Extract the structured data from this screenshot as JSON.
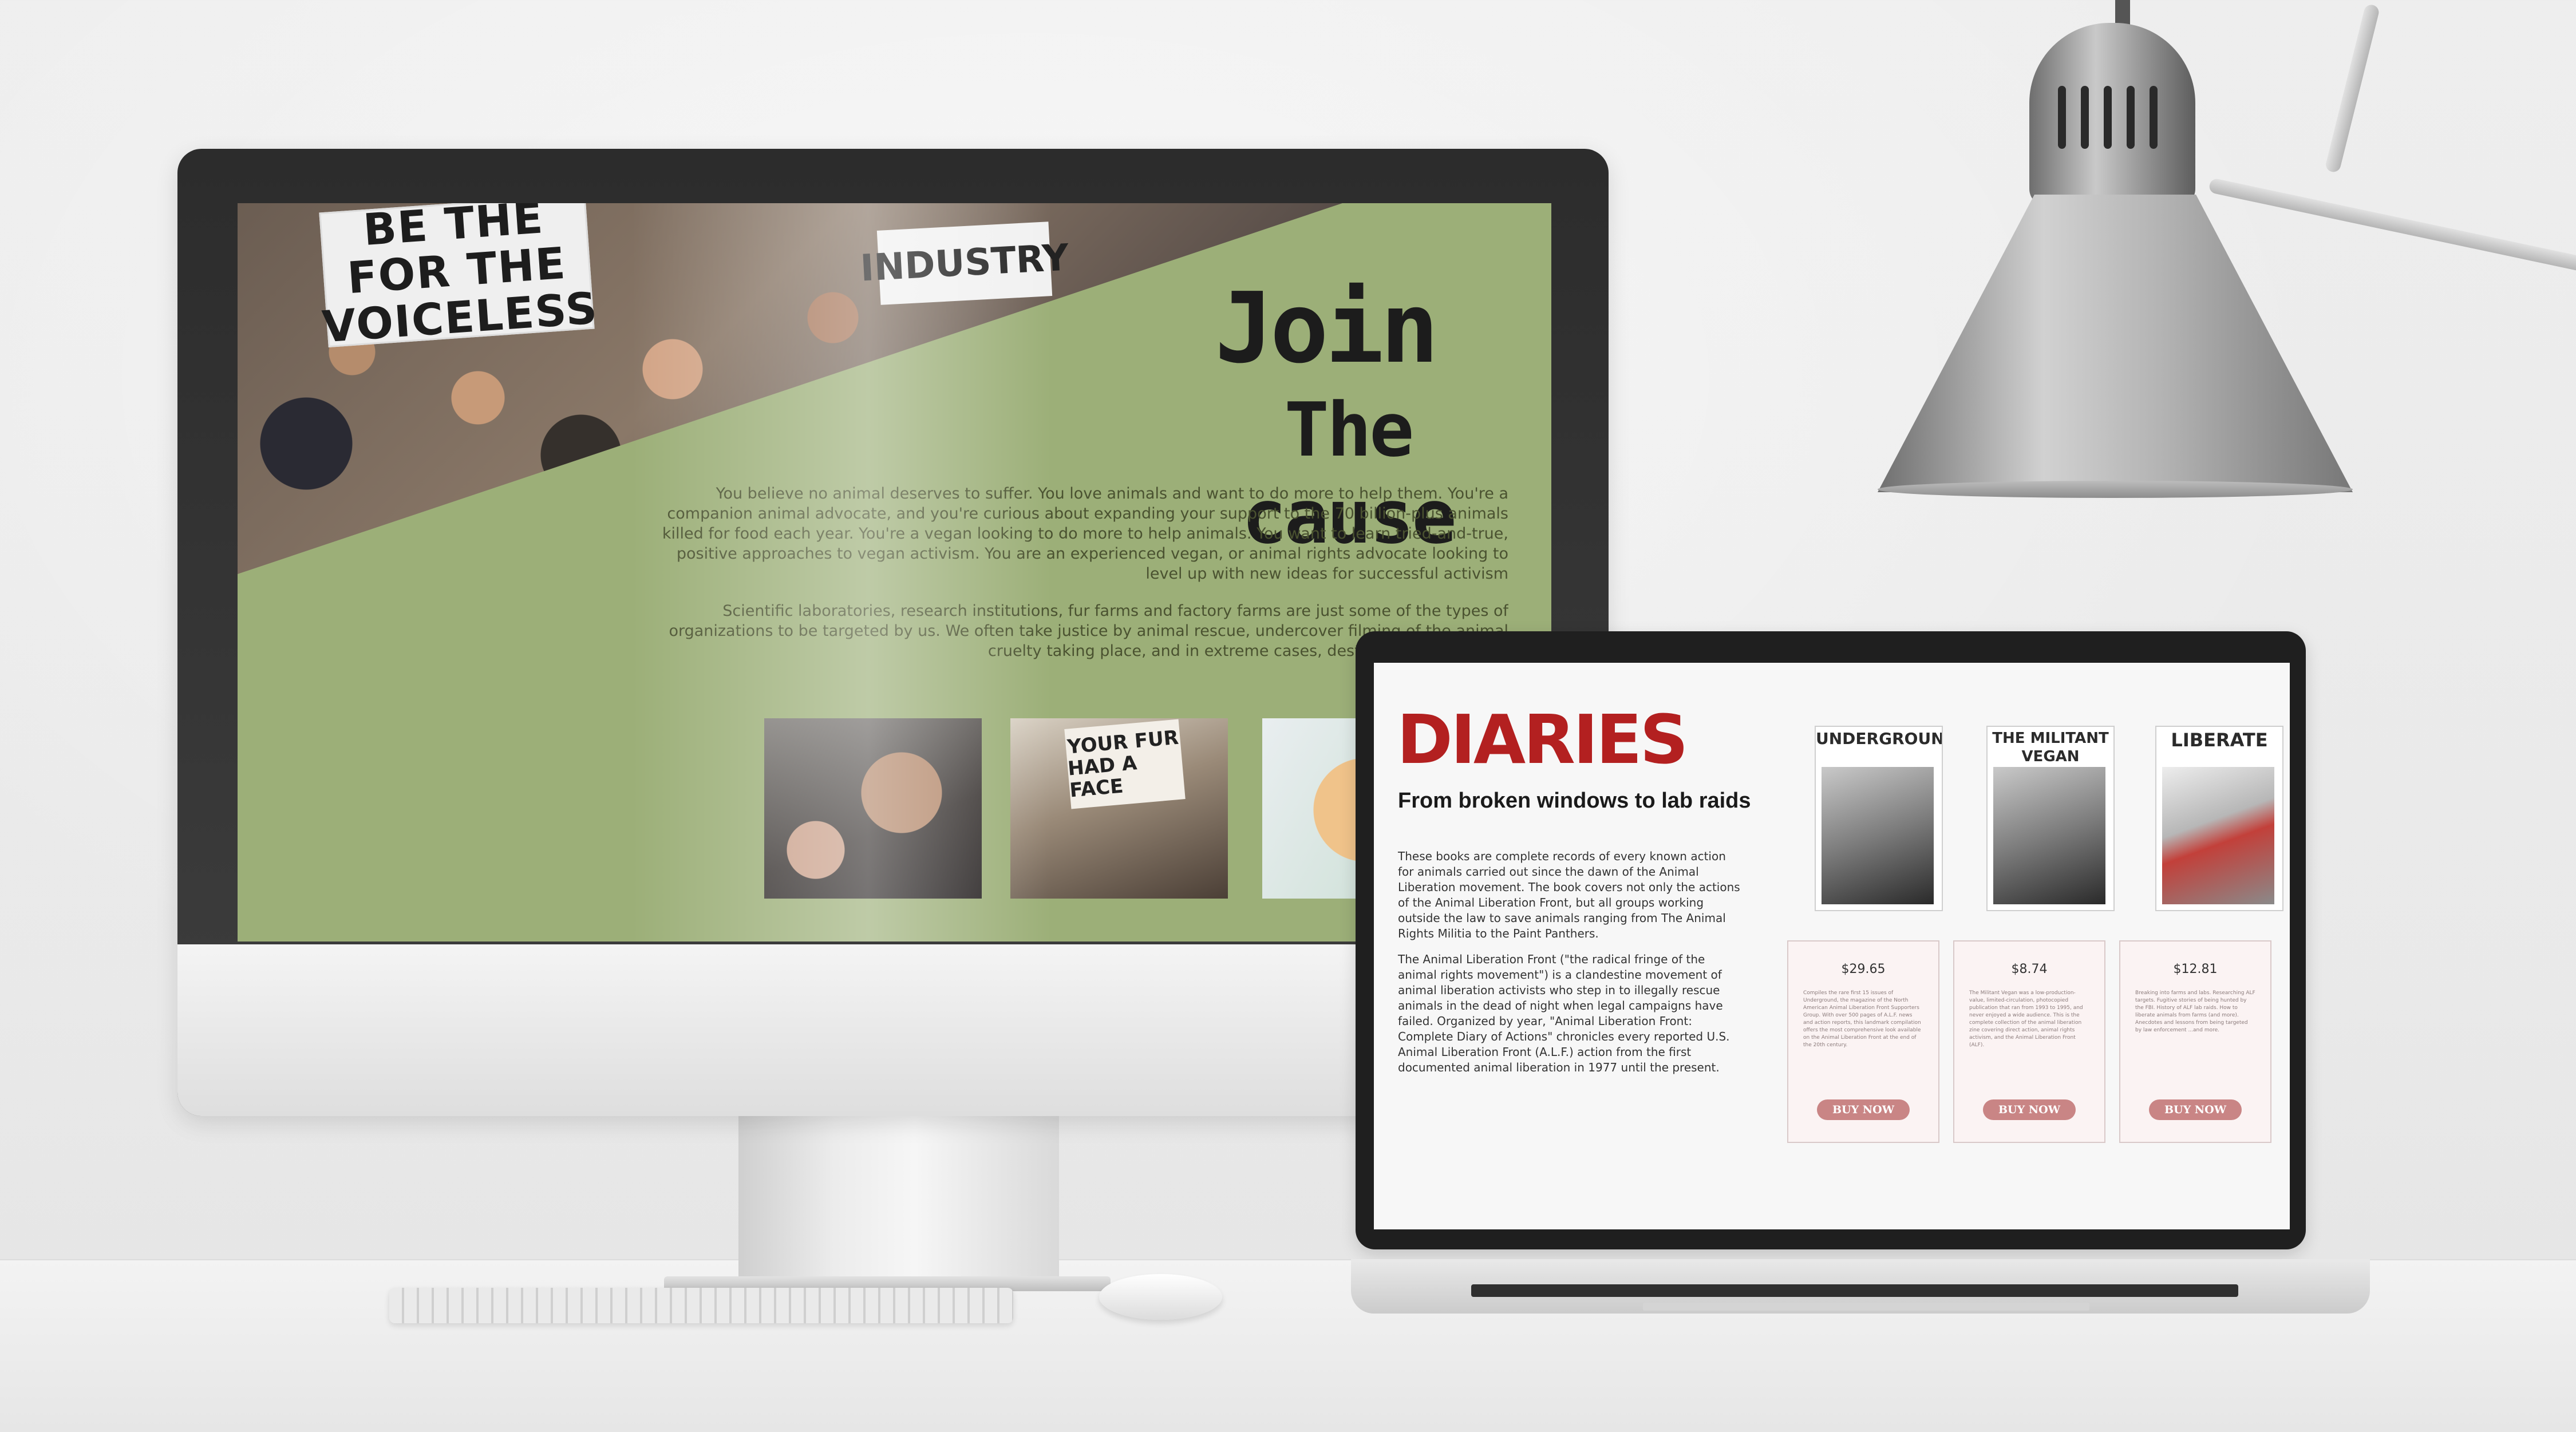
{
  "desktop": {
    "hero": {
      "title_line1": "Join",
      "title_line2": "The cause",
      "sign_voiceless": [
        "BE THE",
        "FOR THE",
        "VOICELESS"
      ],
      "sign_industry": "INDUSTRY",
      "sign_fur": [
        "YOUR FUR",
        "HAD A FACE"
      ],
      "paragraph1": "You believe no animal deserves to suffer. You love animals and want to do more to help them. You're a companion animal advocate, and you're curious about expanding your support to the 70 billion-plus animals killed for food each year. You're a vegan looking to do more to help animals. You want to learn tried-and-true, positive approaches to vegan activism. You are an experienced vegan, or animal rights advocate looking to level up with new ideas for successful activism",
      "paragraph2": "Scientific laboratories, research institutions, fur farms and factory farms are just some of the types of organizations to be targeted by us. We often take justice by animal rescue, undercover filming of the animal cruelty taking place, and in extreme cases, destruction of property."
    }
  },
  "laptop": {
    "title": "DIARIES",
    "subtitle": "From broken windows to lab raids",
    "paragraph1": "These books are complete records of every known action for animals carried out since the dawn of the Animal Liberation movement. The book covers not only the actions of the Animal Liberation Front, but all groups working outside the law to save animals ranging from The Animal Rights Militia to the Paint Panthers.",
    "paragraph2": "The Animal Liberation Front (\"the radical fringe of the animal rights movement\") is a clandestine movement of animal liberation activists who step in to illegally rescue animals in the dead of night when legal campaigns have failed. Organized by year, \"Animal Liberation Front: Complete Diary of Actions\" chronicles every reported U.S. Animal Liberation Front (A.L.F.) action from the first documented animal liberation in 1977 until the present.",
    "books": [
      {
        "cover_title": "UNDERGROUND",
        "price": "$29.65",
        "description": "Compiles the rare first 15 issues of Underground, the magazine of the North American Animal Liberation Front Supporters Group. With over 500 pages of A.L.F. news and action reports, this landmark compilation offers the most comprehensive look available on the Animal Liberation Front at the end of the 20th century.",
        "button": "BUY NOW"
      },
      {
        "cover_title": "THE MILITANT VEGAN",
        "price": "$8.74",
        "description": "The Militant Vegan was a low-production-value, limited-circulation, photocopied publication that ran from 1993 to 1995, and never enjoyed a wide audience. This is the complete collection of the animal liberation zine covering direct action, animal rights activism, and the Animal Liberation Front (ALF).",
        "button": "BUY NOW"
      },
      {
        "cover_title": "LIBERATE",
        "price": "$12.81",
        "description": "Breaking into farms and labs. Researching ALF targets. Fugitive stories of being hunted by the FBI. History of ALF lab raids. How to liberate animals from farms (and more). Anecdotes and lessons from being targeted by law enforcement ...and more.",
        "button": "BUY NOW"
      }
    ]
  },
  "colors": {
    "hero_green": "#9caf78",
    "diaries_red": "#b32020",
    "button_pink": "#c98585",
    "card_bg": "#fbf3f3"
  }
}
